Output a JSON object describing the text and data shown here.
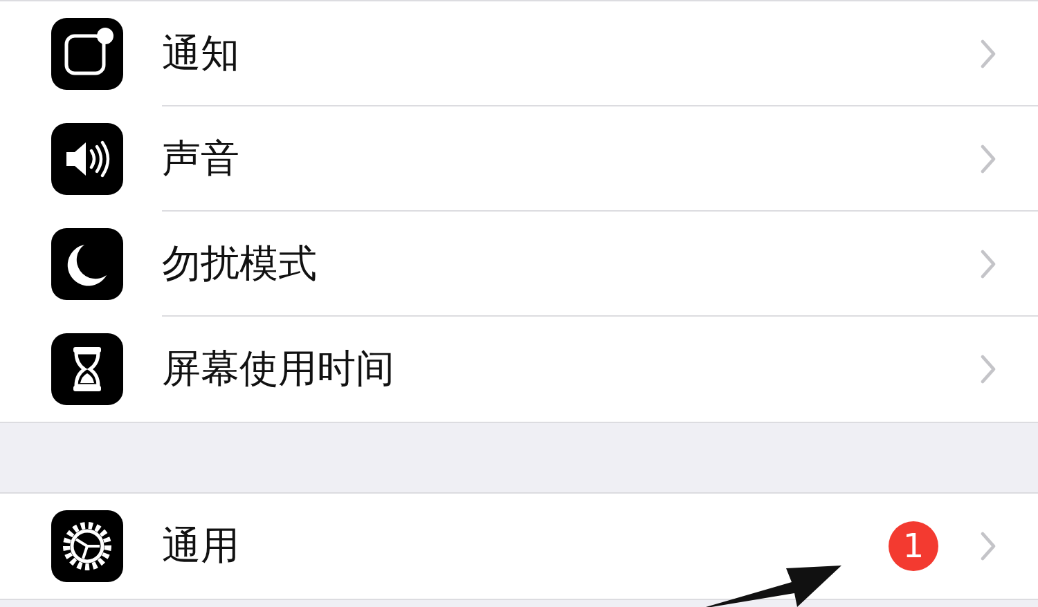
{
  "sections": [
    {
      "items": [
        {
          "kind": "notification",
          "label": "通知"
        },
        {
          "kind": "sound",
          "label": "声音"
        },
        {
          "kind": "moon",
          "label": "勿扰模式"
        },
        {
          "kind": "hourglass",
          "label": "屏幕使用时间"
        }
      ]
    },
    {
      "items": [
        {
          "kind": "gear",
          "label": "通用",
          "badge": "1"
        }
      ]
    }
  ]
}
